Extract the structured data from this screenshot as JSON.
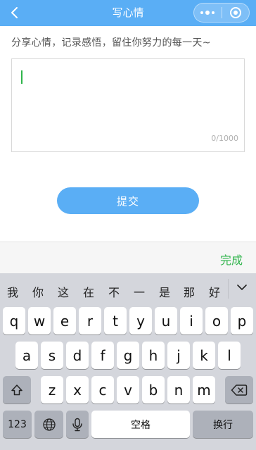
{
  "navbar": {
    "title": "写心情"
  },
  "intro": "分享心情，记录感悟，留住你努力的每一天~",
  "textbox": {
    "counter": "0/1000"
  },
  "submit_label": "提交",
  "done_label": "完成",
  "keyboard": {
    "candidates": [
      "我",
      "你",
      "这",
      "在",
      "不",
      "一",
      "是",
      "那",
      "好"
    ],
    "row1": [
      "q",
      "w",
      "e",
      "r",
      "t",
      "y",
      "u",
      "i",
      "o",
      "p"
    ],
    "row2": [
      "a",
      "s",
      "d",
      "f",
      "g",
      "h",
      "j",
      "k",
      "l"
    ],
    "row3": [
      "z",
      "x",
      "c",
      "v",
      "b",
      "n",
      "m"
    ],
    "num_label": "123",
    "space_label": "空格",
    "return_label": "换行"
  },
  "colors": {
    "brand": "#5aaef5",
    "accent": "#2fb44b"
  }
}
